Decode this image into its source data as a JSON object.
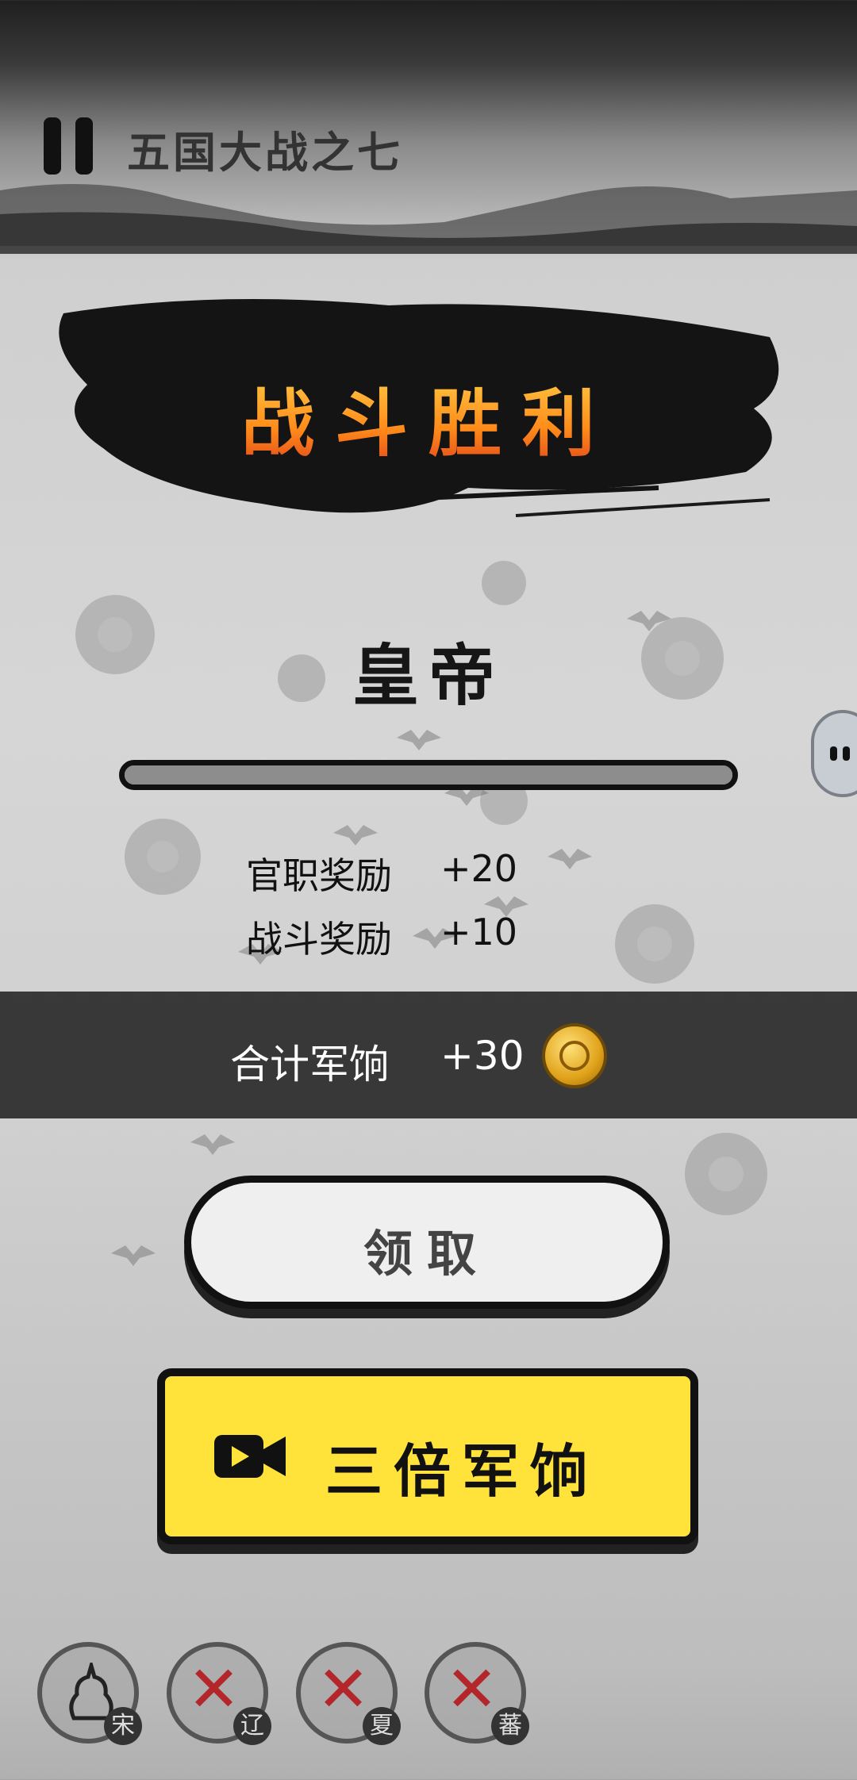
{
  "header": {
    "level_title": "五国大战之七"
  },
  "result": {
    "title": "战斗胜利",
    "rank": "皇帝",
    "rank_progress": 1.0
  },
  "rewards": [
    {
      "label": "官职奖励",
      "value": "+20"
    },
    {
      "label": "战斗奖励",
      "value": "+10"
    }
  ],
  "total": {
    "label": "合计军饷",
    "value": "+30"
  },
  "buttons": {
    "claim": "领取",
    "triple": "三倍军饷"
  },
  "kingdoms": [
    {
      "name": "宋",
      "defeated": false
    },
    {
      "name": "辽",
      "defeated": true
    },
    {
      "name": "夏",
      "defeated": true
    },
    {
      "name": "蕃",
      "defeated": true
    }
  ],
  "colors": {
    "accent_yellow": "#ffe23a",
    "victory_orange": "#ff8c1a",
    "defeat_red": "#b3262a"
  }
}
